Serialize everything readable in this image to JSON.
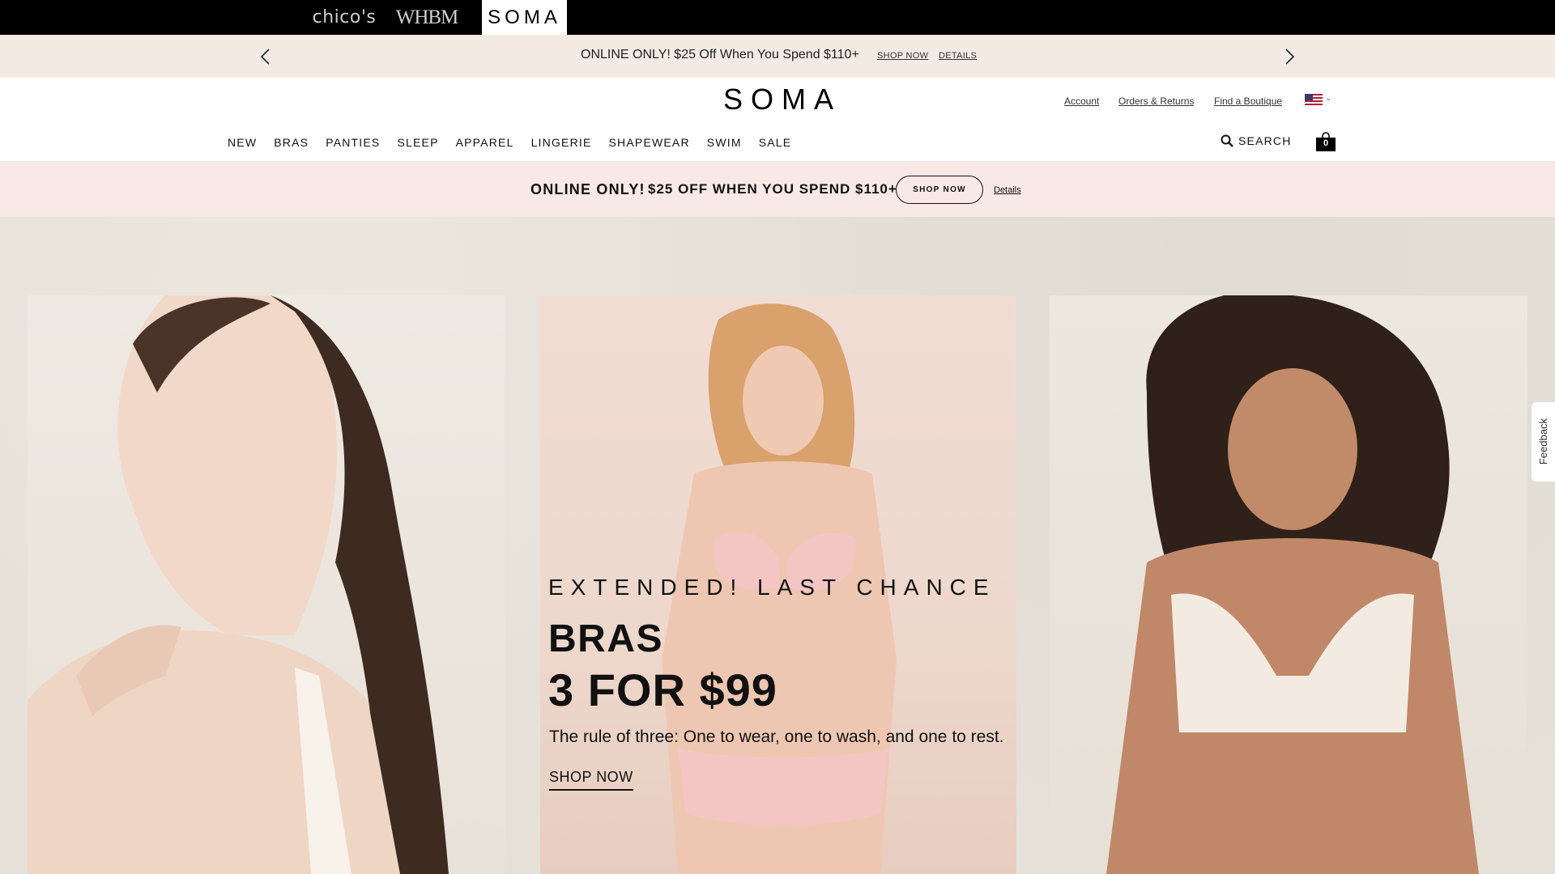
{
  "brandbar": {
    "brands": [
      {
        "label": "chico's"
      },
      {
        "label": "WHBM"
      },
      {
        "label": "SOMA"
      }
    ]
  },
  "promobar": {
    "text": "ONLINE ONLY! $25 Off When You Spend $110+",
    "shop_now": "SHOP NOW",
    "details": "DETAILS"
  },
  "header": {
    "logo": "SOMA",
    "utility_links": {
      "account": "Account",
      "orders": "Orders & Returns",
      "boutique": "Find a Boutique"
    },
    "nav": [
      "NEW",
      "BRAS",
      "PANTIES",
      "SLEEP",
      "APPAREL",
      "LINGERIE",
      "SHAPEWEAR",
      "SWIM",
      "SALE"
    ],
    "search_label": "SEARCH",
    "bag_count": "0"
  },
  "offer_banner": {
    "strong": "ONLINE ONLY!",
    "main": "$25 OFF WHEN YOU SPEND $110+",
    "button": "SHOP NOW",
    "details": "Details"
  },
  "hero": {
    "eyebrow": "EXTENDED! LAST CHANCE",
    "title_line1": "BRAS",
    "title_line2": "3 FOR $99",
    "subtitle": "The rule of three: One to wear, one to wash, and one to rest.",
    "cta": "SHOP NOW"
  },
  "feedback": {
    "label": "Feedback"
  },
  "colors": {
    "brandbar_bg": "#000000",
    "promobar_bg": "#f3ebe3",
    "offer_bg": "#f8e8e6",
    "hero_bg": "#e5e1d9"
  }
}
